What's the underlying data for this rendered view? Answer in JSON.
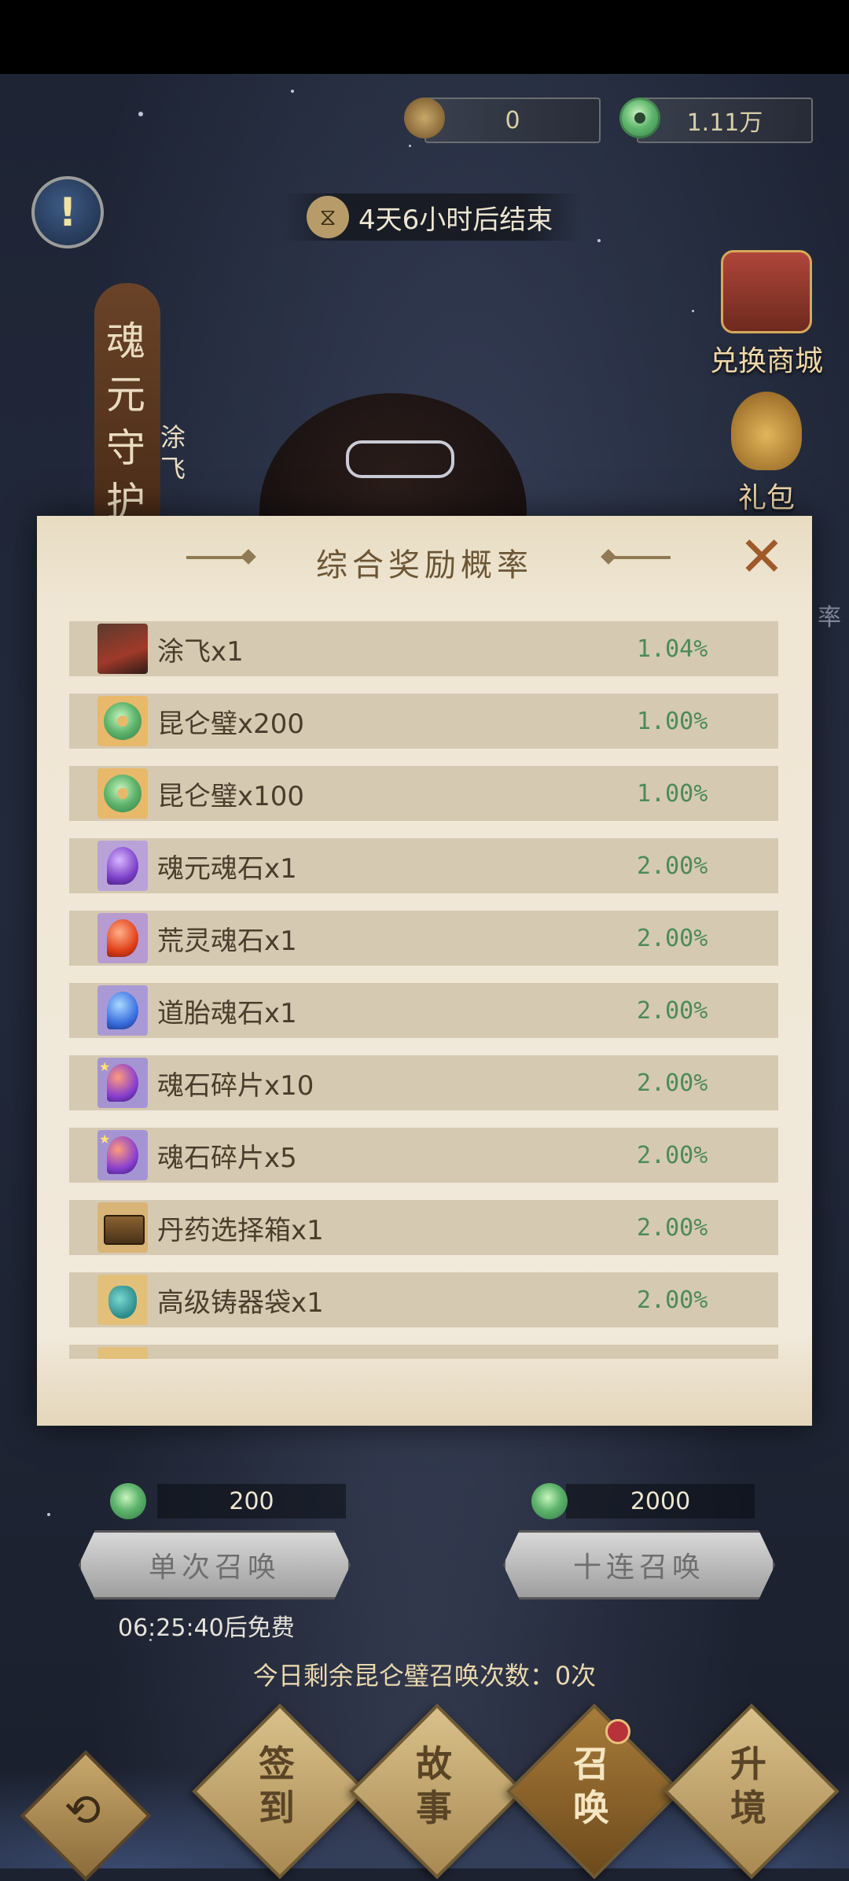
{
  "header": {
    "currency_left": {
      "icon": "lantern-token-icon",
      "value": "0"
    },
    "currency_right": {
      "icon": "jade-disc-icon",
      "value": "1.11万"
    }
  },
  "event": {
    "info_icon": "!",
    "timer_icon": "⧖",
    "timer_text": "4天6小时后结束"
  },
  "banner": {
    "title": "魂元守护",
    "subtitle": "涂飞"
  },
  "side_buttons": {
    "shop_label": "兑换商城",
    "bag_label": "礼包"
  },
  "right_edge_text": "率",
  "modal": {
    "title": "综合奖励概率",
    "close": "✕",
    "rows": [
      {
        "name": "涂飞x1",
        "prob": "1.04%",
        "icon": "character-avatar-icon"
      },
      {
        "name": "昆仑璧x200",
        "prob": "1.00%",
        "icon": "jade-disc-icon"
      },
      {
        "name": "昆仑璧x100",
        "prob": "1.00%",
        "icon": "jade-disc-icon"
      },
      {
        "name": "魂元魂石x1",
        "prob": "2.00%",
        "icon": "purple-soul-stone-icon"
      },
      {
        "name": "荒灵魂石x1",
        "prob": "2.00%",
        "icon": "red-soul-stone-icon"
      },
      {
        "name": "道胎魂石x1",
        "prob": "2.00%",
        "icon": "blue-soul-stone-icon"
      },
      {
        "name": "魂石碎片x10",
        "prob": "2.00%",
        "icon": "soul-stone-shard-icon"
      },
      {
        "name": "魂石碎片x5",
        "prob": "2.00%",
        "icon": "soul-stone-shard-icon"
      },
      {
        "name": "丹药选择箱x1",
        "prob": "2.00%",
        "icon": "pill-chest-icon"
      },
      {
        "name": "高级铸器袋x1",
        "prob": "2.00%",
        "icon": "forging-bag-icon"
      }
    ]
  },
  "summon": {
    "single": {
      "cost": "200",
      "label": "单次召唤"
    },
    "ten": {
      "cost": "2000",
      "label": "十连召唤"
    },
    "free_timer": "06:25:40后免费",
    "daily_count": "今日剩余昆仑璧召唤次数：0次"
  },
  "nav": {
    "back": "⟲",
    "items": [
      {
        "label_1": "签",
        "label_2": "到"
      },
      {
        "label_1": "故",
        "label_2": "事"
      },
      {
        "label_1": "召",
        "label_2": "唤"
      },
      {
        "label_1": "升",
        "label_2": "境"
      }
    ]
  }
}
